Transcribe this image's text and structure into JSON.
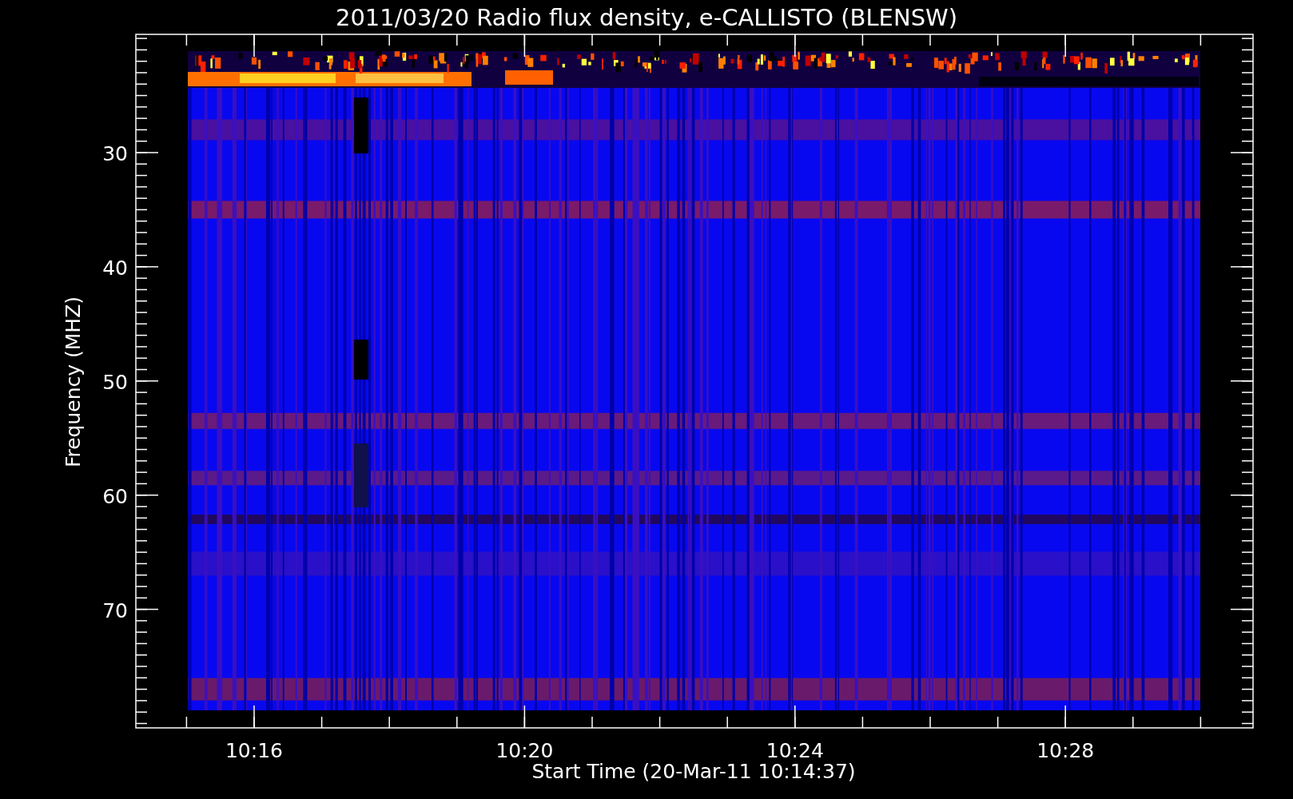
{
  "title": "2011/03/20  Radio flux density, e-CALLISTO (BLENSW)",
  "y_axis": {
    "label": "Frequency (MHZ)",
    "ticks": [
      "30",
      "40",
      "50",
      "60",
      "70"
    ]
  },
  "x_axis": {
    "label": "Start Time (20-Mar-11 10:14:37)",
    "ticks": [
      "10:16",
      "10:20",
      "10:24",
      "10:28"
    ]
  }
}
